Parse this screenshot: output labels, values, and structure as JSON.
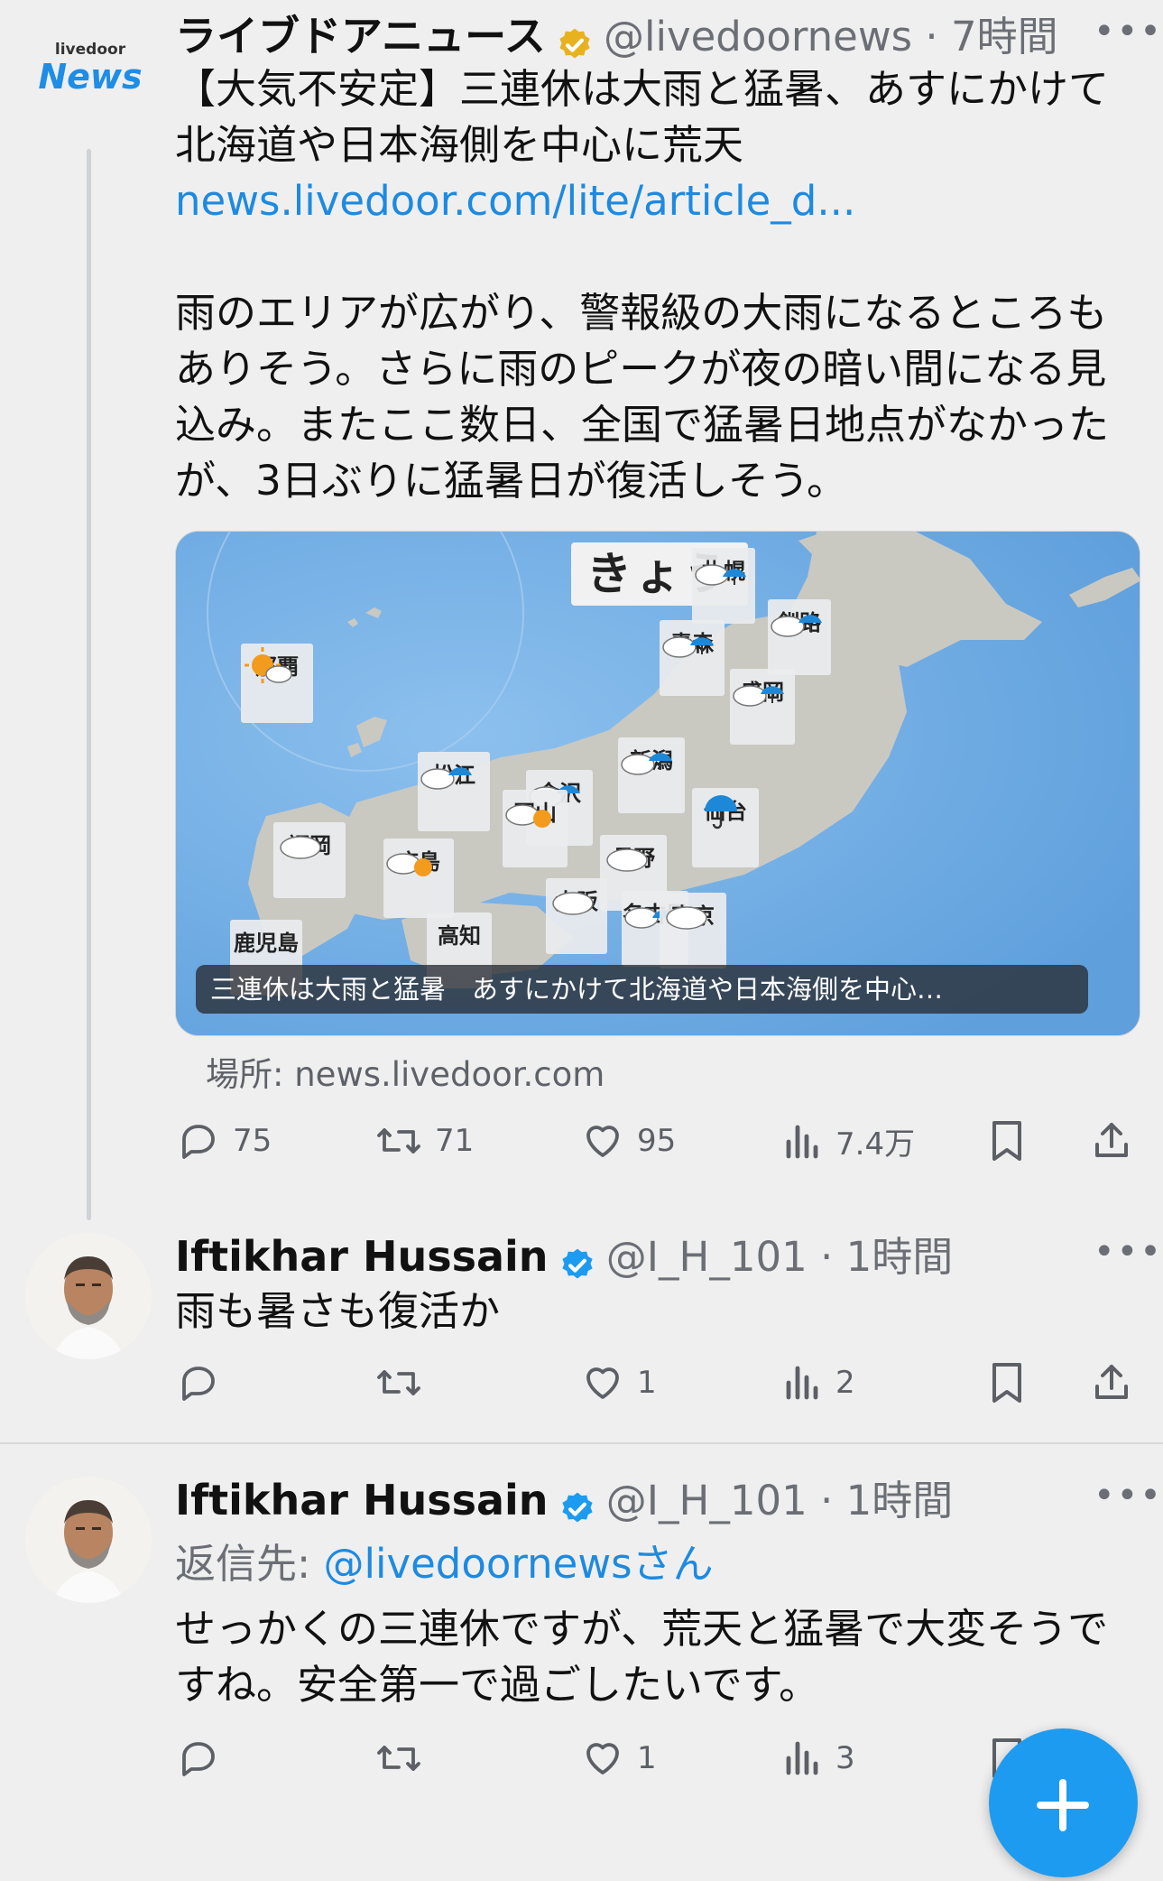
{
  "tweet1": {
    "logo_small": "livedoor",
    "logo_big": "News",
    "name": "ライブドアニュース",
    "handle": "@livedoornews",
    "time": "7時間",
    "more": "•••",
    "headline_1": "【大気不安定】三連休は大雨と猛暑、あすにかけて",
    "headline_2": "北海道や日本海側を中心に荒天",
    "link": "news.livedoor.com/lite/article_d...",
    "para_1": "雨のエリアが広がり、警報級の大雨になるところも",
    "para_2": "ありそう。さらに雨のピークが夜の暗い間になる見",
    "para_3": "込み。またここ数日、全国で猛暑日地点がなかった",
    "para_4": "が、3日ぶりに猛暑日が復活しそう。",
    "card": {
      "map_title": "きょう",
      "caption": "三連休は大雨と猛暑　あすにかけて北海道や日本海側を中心…",
      "cities": [
        "札幌",
        "釧路",
        "青森",
        "盛岡",
        "那覇",
        "新潟",
        "仙台",
        "松江",
        "金沢",
        "岡山",
        "福岡",
        "広島",
        "長野",
        "大阪",
        "名古屋",
        "東京",
        "高知",
        "鹿児島"
      ]
    },
    "source": "場所: news.livedoor.com",
    "replies": "75",
    "retweets": "71",
    "likes": "95",
    "views": "7.4万"
  },
  "tweet2": {
    "name": "Iftikhar Hussain",
    "handle": "@I_H_101",
    "time": "1時間",
    "more": "•••",
    "text": "雨も暑さも復活か",
    "likes": "1",
    "views": "2"
  },
  "tweet3": {
    "name": "Iftikhar Hussain",
    "handle": "@I_H_101",
    "time": "1時間",
    "more": "•••",
    "reply_prefix": "返信先: ",
    "reply_to": "@livedoornews",
    "reply_suffix": "さん",
    "text_1": "せっかくの三連休ですが、荒天と猛暑で大変そうで",
    "text_2": "すね。安全第一で過ごしたいです。",
    "likes": "1",
    "views": "3"
  },
  "colors": {
    "accent": "#1d9bf0",
    "link": "#1d8ae0",
    "verified_gold": "#e8b21f",
    "verified_blue": "#1d9bf0"
  },
  "icons": [
    "reply-icon",
    "retweet-icon",
    "like-icon",
    "views-icon",
    "bookmark-icon",
    "share-icon",
    "verified-badge-icon",
    "compose-plus-icon"
  ]
}
